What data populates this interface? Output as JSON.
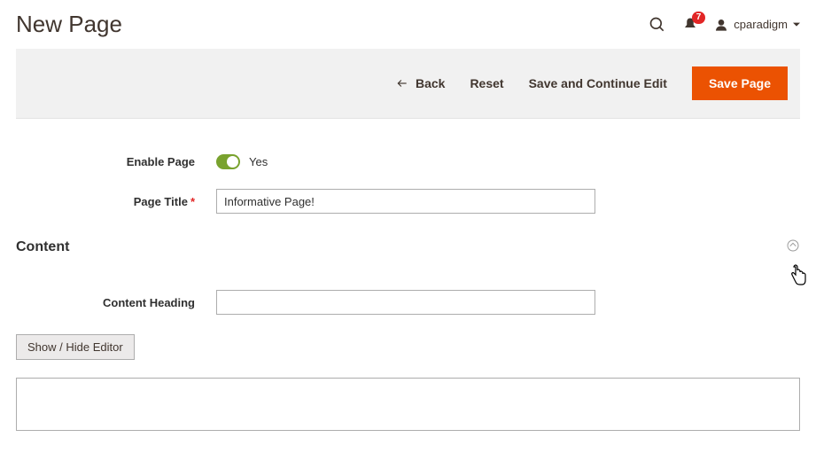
{
  "header": {
    "title": "New Page",
    "notification_count": "7",
    "username": "cparadigm"
  },
  "action_bar": {
    "back": "Back",
    "reset": "Reset",
    "save_continue": "Save and Continue Edit",
    "save": "Save Page"
  },
  "form": {
    "enable_label": "Enable Page",
    "enable_value": "Yes",
    "page_title_label": "Page Title",
    "page_title_value": "Informative Page!"
  },
  "content_section": {
    "title": "Content",
    "heading_label": "Content Heading",
    "heading_value": "",
    "editor_toggle": "Show / Hide Editor",
    "editor_value": ""
  }
}
